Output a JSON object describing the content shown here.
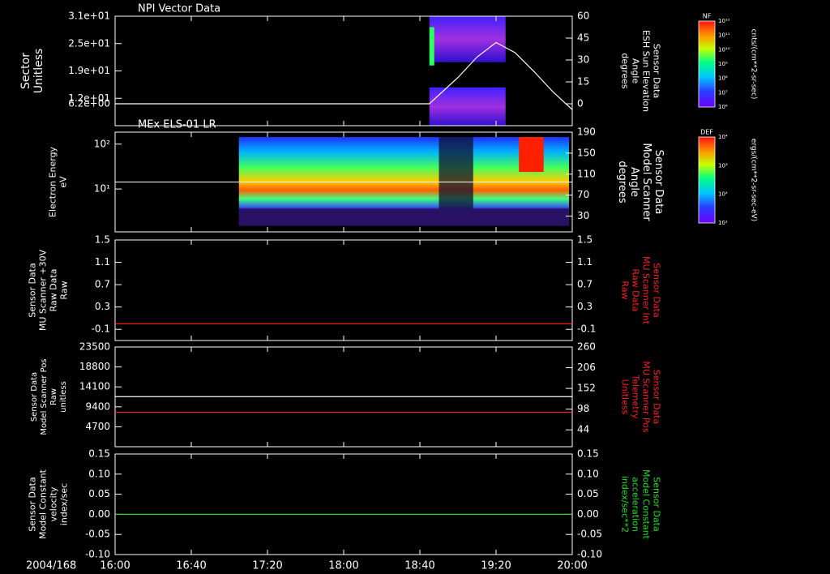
{
  "colors": {
    "background": "#000000",
    "axis": "#ffffff",
    "trace_white": "#ffffff",
    "trace_red": "#ff2020",
    "trace_green": "#20e020"
  },
  "chart_data": [
    {
      "type": "heatmap",
      "title": "NPI Vector Data",
      "ylabel": [
        "Sector",
        "Unitless"
      ],
      "yticks": [
        "3.1e+01",
        "2.5e+01",
        "1.9e+01",
        "1.2e+01",
        "6.2e+00"
      ],
      "ylim": [
        0,
        31
      ],
      "right_ticks": [
        "60",
        "45",
        "30",
        "15",
        "0"
      ],
      "right_lim": [
        -15,
        60
      ],
      "right_label": [
        "Sensor Data",
        "ESH Sun Elevation",
        "Angle",
        "degrees"
      ],
      "colorbar": {
        "name": "NF",
        "label": "cnts/(cm**2-sr-sec)",
        "ticks": [
          "10¹²",
          "10¹¹",
          "10¹⁰",
          "10⁹",
          "10⁸",
          "10⁷",
          "10⁶"
        ]
      },
      "trace_elevation": {
        "x": [
          "16:00",
          "18:45",
          "19:00",
          "19:10",
          "19:20",
          "19:30",
          "19:40",
          "19:50",
          "20:00"
        ],
        "y": [
          0,
          0,
          18,
          32,
          42,
          35,
          22,
          8,
          -4
        ]
      }
    },
    {
      "type": "heatmap",
      "title": "MEx ELS-01 LR",
      "ylabel": [
        "Electron Energy",
        "eV"
      ],
      "yticks": [
        "10²",
        "10¹"
      ],
      "right_ticks": [
        "190",
        "150",
        "110",
        "70",
        "30"
      ],
      "right_lim": [
        0,
        190
      ],
      "right_label": [
        "Sensor Data",
        "Model Scanner",
        "Angle",
        "degrees"
      ],
      "colorbar": {
        "name": "DEF",
        "label": "ergs/(cm**2-sr-sec-eV)",
        "ticks": [
          "10⁴",
          "10³",
          "10²",
          "10¹"
        ]
      },
      "trace_scanner_angle": {
        "x": [
          "16:00",
          "20:00"
        ],
        "y": [
          95,
          95
        ]
      }
    },
    {
      "type": "line",
      "ylabel": [
        "Sensor Data",
        "MU Scanner +30V",
        "Raw Data",
        "Raw"
      ],
      "yticks": [
        "1.5",
        "1.1",
        "0.7",
        "0.3",
        "-0.1"
      ],
      "ylim": [
        -0.3,
        1.5
      ],
      "right_ticks": [
        "1.5",
        "1.1",
        "0.7",
        "0.3",
        "-0.1"
      ],
      "right_lim": [
        -0.3,
        1.5
      ],
      "right_label": [
        "Sensor Data",
        "MU Scanner Int",
        "Raw Data",
        "Raw"
      ],
      "series": [
        {
          "name": "MU Scanner Int",
          "values": [
            0.0,
            0.0
          ],
          "color": "#ff2020"
        }
      ],
      "x": [
        "16:00",
        "20:00"
      ]
    },
    {
      "type": "line",
      "ylabel": [
        "Sensor Data",
        "Model Scanner Pos",
        "Raw",
        "unitless"
      ],
      "yticks": [
        "23500",
        "18800",
        "14100",
        "9400",
        "4700"
      ],
      "ylim": [
        0,
        23500
      ],
      "right_ticks": [
        "260",
        "206",
        "152",
        "98",
        "44"
      ],
      "right_lim": [
        0,
        260
      ],
      "right_label": [
        "Sensor Data",
        "MU Scanner Pos",
        "Telemetry",
        "Unitless"
      ],
      "series": [
        {
          "name": "Model Scanner Pos",
          "values": [
            11800,
            11800
          ],
          "color": "#ffffff",
          "axis": "left"
        },
        {
          "name": "MU Scanner Pos",
          "values": [
            90,
            90
          ],
          "color": "#ff2020",
          "axis": "right"
        }
      ],
      "x": [
        "16:00",
        "20:00"
      ]
    },
    {
      "type": "line",
      "ylabel": [
        "Sensor Data",
        "Model Constant",
        "velocity",
        "index/sec"
      ],
      "yticks": [
        "0.15",
        "0.10",
        "0.05",
        "0.00",
        "-0.05",
        "-0.10"
      ],
      "ylim": [
        -0.1,
        0.15
      ],
      "right_ticks": [
        "0.15",
        "0.10",
        "0.05",
        "0.00",
        "-0.05",
        "-0.10"
      ],
      "right_lim": [
        -0.1,
        0.15
      ],
      "right_label": [
        "Sensor Data",
        "Model Constant",
        "acceleration",
        "index/sec**2"
      ],
      "series": [
        {
          "name": "Model Constant",
          "values": [
            0.0,
            0.0
          ],
          "color": "#20e020"
        }
      ],
      "x": [
        "16:00",
        "20:00"
      ]
    }
  ],
  "xaxis": {
    "date_label": "2004/168",
    "ticks": [
      "16:00",
      "16:40",
      "17:20",
      "18:00",
      "18:40",
      "19:20",
      "20:00"
    ],
    "range": [
      "16:00",
      "20:00"
    ]
  }
}
